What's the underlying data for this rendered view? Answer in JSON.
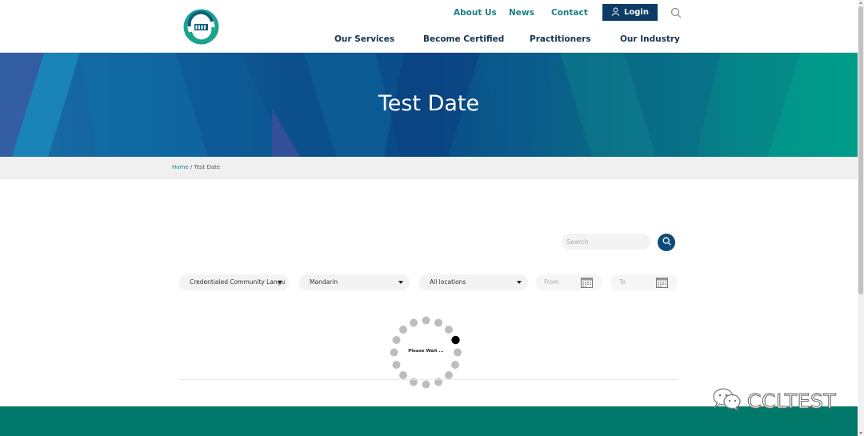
{
  "header": {
    "top_links": [
      "About Us",
      "News",
      "Contact"
    ],
    "login_label": "Login",
    "main_nav": [
      "Our Services",
      "Become Certified",
      "Practitioners",
      "Our Industry"
    ]
  },
  "banner": {
    "title": "Test Date"
  },
  "breadcrumb": {
    "home": "Home",
    "separator": " / ",
    "current": "Test Date"
  },
  "search": {
    "placeholder": "Search"
  },
  "filters": {
    "test_type": "Credentialed Community Langu",
    "language": "Mandarin",
    "location": "All locations",
    "from_placeholder": "From",
    "to_placeholder": "To"
  },
  "loader": {
    "text": "Please Wait ..."
  },
  "watermark": {
    "text": "CCLTEST"
  },
  "colors": {
    "teal": "#1a7f86",
    "navy": "#0d3b66",
    "footer": "#00796b"
  }
}
